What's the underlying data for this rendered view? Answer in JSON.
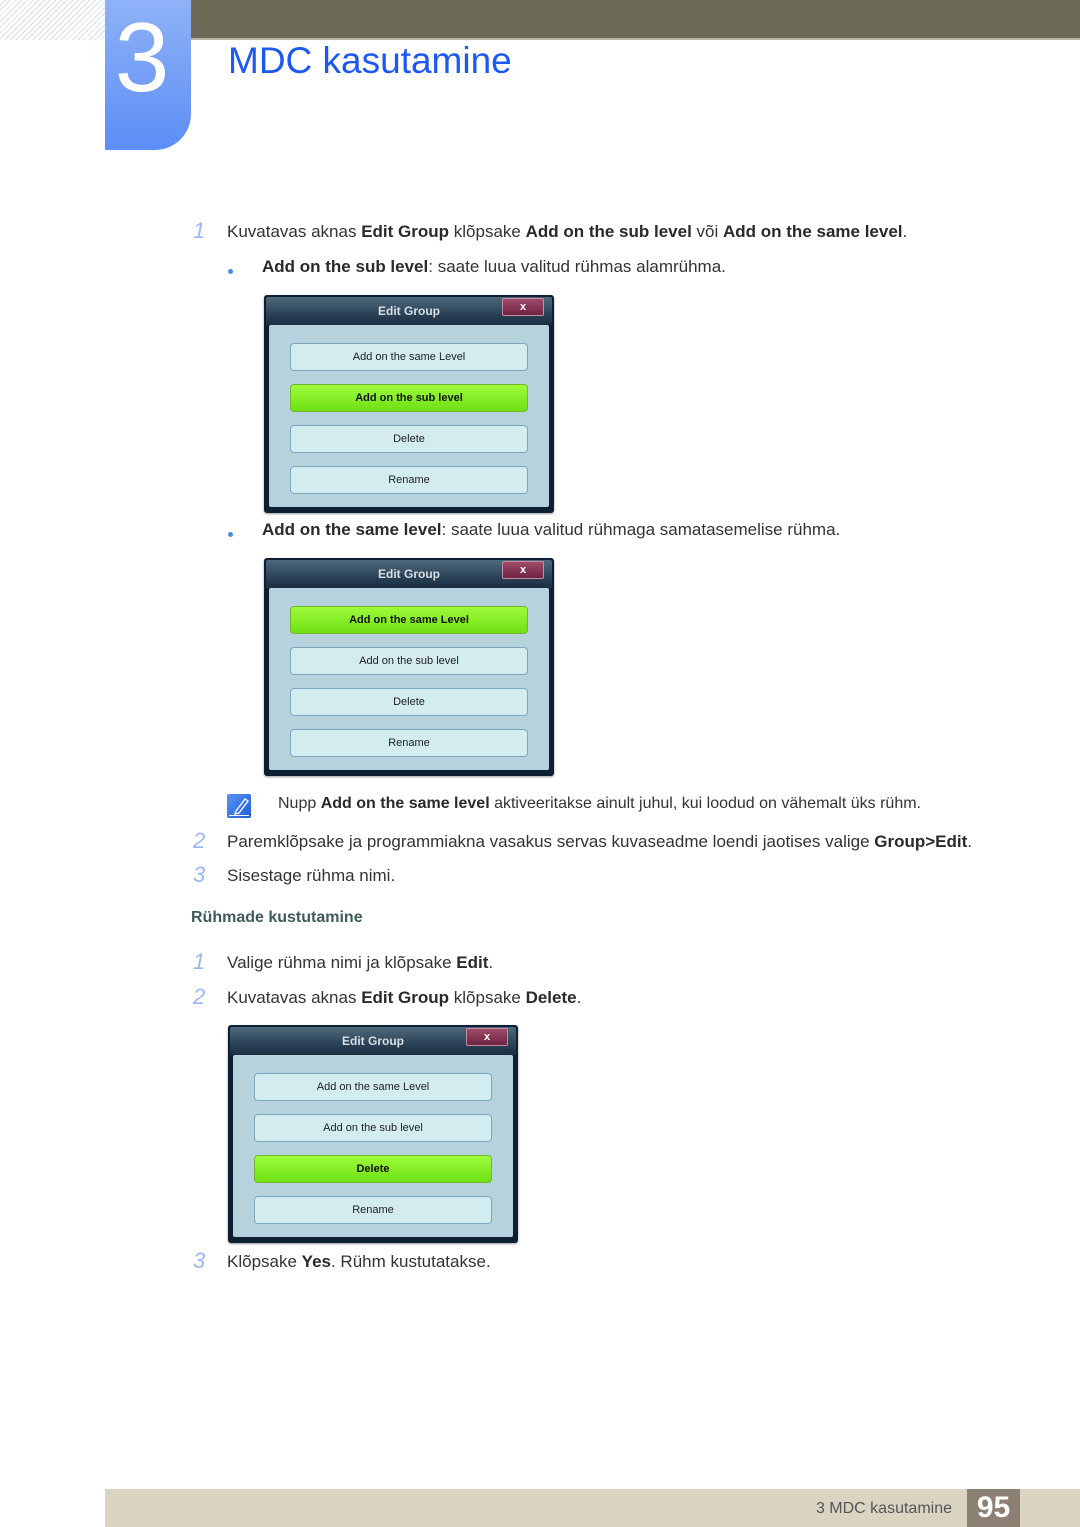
{
  "header": {
    "chapter_number": "3",
    "chapter_title": "MDC kasutamine"
  },
  "steps_add": [
    {
      "num": "1",
      "parts": [
        [
          "Kuvatavas aknas ",
          false
        ],
        [
          "Edit Group",
          true
        ],
        [
          " klõpsake ",
          false
        ],
        [
          "Add on the sub level",
          true
        ],
        [
          " või ",
          false
        ],
        [
          "Add on the same level",
          true
        ],
        [
          ".",
          false
        ]
      ]
    }
  ],
  "bullets": [
    {
      "term": "Add on the sub level",
      "desc": ": saate luua valitud rühmas alamrühma."
    },
    {
      "term": "Add on the same level",
      "desc": ": saate luua valitud rühmaga samatasemelise rühma."
    }
  ],
  "dialogs": [
    {
      "title": "Edit Group",
      "close": "x",
      "buttons": [
        "Add on the same Level",
        "Add on the sub level",
        "Delete",
        "Rename"
      ],
      "active": 1
    },
    {
      "title": "Edit Group",
      "close": "x",
      "buttons": [
        "Add on the same Level",
        "Add on the sub level",
        "Delete",
        "Rename"
      ],
      "active": 0
    },
    {
      "title": "Edit Group",
      "close": "x",
      "buttons": [
        "Add on the same Level",
        "Add on the sub level",
        "Delete",
        "Rename"
      ],
      "active": 2
    }
  ],
  "note": {
    "prefix": "Nupp ",
    "bold": "Add on the same level",
    "suffix": " aktiveeritakse ainult juhul, kui loodud on vähemalt üks rühm."
  },
  "steps_more": [
    {
      "num": "2",
      "parts": [
        [
          "Paremklõpsake ja programmiakna vasakus servas kuvaseadme loendi jaotises valige ",
          false
        ],
        [
          "Group>Edit",
          true
        ],
        [
          ".",
          false
        ]
      ]
    },
    {
      "num": "3",
      "parts": [
        [
          "Sisestage rühma nimi.",
          false
        ]
      ]
    }
  ],
  "section_delete": {
    "heading": "Rühmade kustutamine",
    "steps": [
      {
        "num": "1",
        "parts": [
          [
            "Valige rühma nimi ja klõpsake ",
            false
          ],
          [
            "Edit",
            true
          ],
          [
            ".",
            false
          ]
        ]
      },
      {
        "num": "2",
        "parts": [
          [
            "Kuvatavas aknas ",
            false
          ],
          [
            "Edit Group",
            true
          ],
          [
            " klõpsake ",
            false
          ],
          [
            "Delete",
            true
          ],
          [
            ".",
            false
          ]
        ]
      },
      {
        "num": "3",
        "parts": [
          [
            "Klõpsake ",
            false
          ],
          [
            "Yes",
            true
          ],
          [
            ". Rühm kustutatakse.",
            false
          ]
        ]
      }
    ]
  },
  "footer": {
    "label": "3 MDC kasutamine",
    "page": "95"
  },
  "colors": {
    "accent_blue": "#1b59f2",
    "active_green": "#7fe81f",
    "header_bar": "#6d6b58",
    "footer_bar": "#d9d5c2",
    "page_box": "#8b8073"
  }
}
